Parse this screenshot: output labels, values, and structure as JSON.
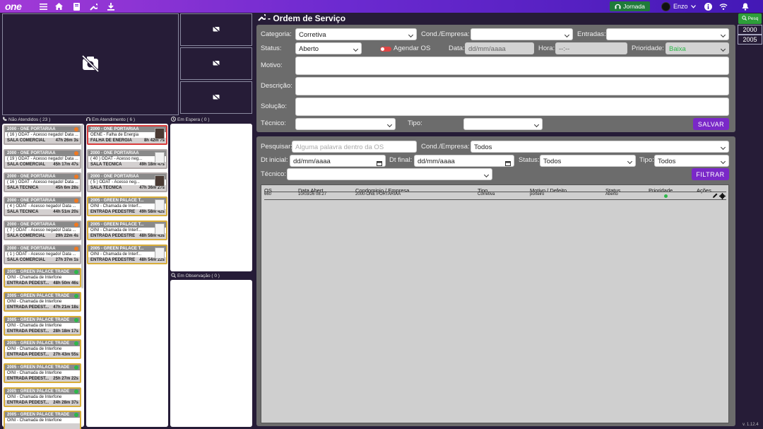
{
  "topbar": {
    "logo": "one",
    "jornada": "Jornada",
    "user": "Enzo"
  },
  "columns": {
    "nao_atendidos": "Não Atendidos ( 23 )",
    "em_atendimento": "Em Atendimento ( 6 )",
    "em_espera": "Em Espera ( 0 )",
    "em_observacao": "Em Observação ( 0 )"
  },
  "nao_atendidos": [
    {
      "h": "2000 - ONE PORTARIAA",
      "l": "( 16 ) ODAT - Acesso negado! Data ...",
      "f": "SALA COMERCIAL",
      "t": "47h 26m 3s",
      "dot": "o",
      "kind": "gray"
    },
    {
      "h": "2000 - ONE PORTARIAA",
      "l": "( 19 ) ODAT - Acesso negado! Data ...",
      "f": "SALA COMERCIAL",
      "t": "45h 17m 47s",
      "dot": "o",
      "kind": "gray"
    },
    {
      "h": "2000 - ONE PORTARIAA",
      "l": "( 16 ) ODAT - Acesso negado! Data ...",
      "f": "SALA TECNICA",
      "t": "45h 6m 28s",
      "dot": "o",
      "kind": "gray"
    },
    {
      "h": "2000 - ONE PORTARIAA",
      "l": "( 4 ) ODAT - Acesso negado! Data ...",
      "f": "SALA TECNICA",
      "t": "44h 51m 20s",
      "dot": "o",
      "kind": "gray"
    },
    {
      "h": "2000 - ONE PORTARIAA",
      "l": "( 7 ) ODAT - Acesso negado! Data ...",
      "f": "SALA COMERCIAL",
      "t": "29h 22m 4s",
      "dot": "o",
      "kind": "gray"
    },
    {
      "h": "2000 - ONE PORTARIAA",
      "l": "( 1 ) ODAT - Acesso negado! Data ...",
      "f": "SALA COMERCIAL",
      "t": "27h 37m 1s",
      "dot": "o",
      "kind": "gray"
    },
    {
      "h": "2005 - GREEN PALACE TRADE",
      "l": "OINI - Chamada de Interfone",
      "f": "ENTRADA PEDEST...",
      "t": "48h 50m 46s",
      "dot": "g",
      "kind": "green"
    },
    {
      "h": "2005 - GREEN PALACE TRADE",
      "l": "OINI - Chamada de Interfone",
      "f": "ENTRADA PEDEST...",
      "t": "47h 21m 18s",
      "dot": "g",
      "kind": "green"
    },
    {
      "h": "2005 - GREEN PALACE TRADE",
      "l": "OINI - Chamada de Interfone",
      "f": "ENTRADA PEDEST...",
      "t": "28h 18m 17s",
      "dot": "g",
      "kind": "green"
    },
    {
      "h": "2005 - GREEN PALACE TRADE",
      "l": "OINI - Chamada de Interfone",
      "f": "ENTRADA PEDEST...",
      "t": "27h 43m 55s",
      "dot": "g",
      "kind": "green"
    },
    {
      "h": "2005 - GREEN PALACE TRADE",
      "l": "OINI - Chamada de Interfone",
      "f": "ENTRADA PEDEST...",
      "t": "25h 27m 22s",
      "dot": "g",
      "kind": "green"
    },
    {
      "h": "2005 - GREEN PALACE TRADE",
      "l": "OINI - Chamada de Interfone",
      "f": "ENTRADA PEDEST...",
      "t": "24h 28m 37s",
      "dot": "g",
      "kind": "green"
    },
    {
      "h": "2005 - GREEN PALACE TRADE",
      "l": "OINI - Chamada de Interfone",
      "f": "",
      "t": "",
      "dot": "g",
      "kind": "green"
    }
  ],
  "em_atendimento": [
    {
      "h": "2000 - ONE PORTARIAA",
      "l": "OENE - Falha de Energia",
      "f": "FALHA DE ENERGIA",
      "t": "8h 42m 7s",
      "kind": "red",
      "thumb": "face"
    },
    {
      "h": "2000 - ONE PORTARIAA",
      "l": "( 40 ) ODAT - Acesso neg...",
      "f": "SALA TECNICA",
      "t": "49h 18m 47s",
      "kind": "gray",
      "thumb": "ph"
    },
    {
      "h": "2000 - ONE PORTARIAA",
      "l": "( 5 ) ODAT - Acesso neg...",
      "f": "SALA TECNICA",
      "t": "47h 36m 27s",
      "kind": "gray",
      "thumb": "face"
    },
    {
      "h": "2005 - GREEN PALACE T...",
      "l": "OINI - Chamada de Interf...",
      "f": "ENTRADA PEDESTRE",
      "t": "49h 58m 42s",
      "kind": "green",
      "thumb": "ph"
    },
    {
      "h": "2005 - GREEN PALACE T...",
      "l": "OINI - Chamada de Interf...",
      "f": "ENTRADA PEDESTRE",
      "t": "48h 58m 43s",
      "kind": "green",
      "thumb": "ph"
    },
    {
      "h": "2005 - GREEN PALACE T...",
      "l": "OINI - Chamada de Interf...",
      "f": "ENTRADA PEDESTRE",
      "t": "48h 54m 22s",
      "kind": "green",
      "thumb": "ph"
    }
  ],
  "os_form": {
    "title": "- Ordem de Serviço",
    "categoria_label": "Categoria:",
    "categoria": "Corretiva",
    "cond_label": "Cond./Empresa:",
    "cond": "",
    "entradas_label": "Entradas:",
    "entradas": "",
    "status_label": "Status:",
    "status": "Aberto",
    "agendar_label": "Agendar OS",
    "data_label": "Data:",
    "data": "dd/mm/aaaa",
    "hora_label": "Hora:",
    "hora": "--:--",
    "prioridade_label": "Prioridade:",
    "prioridade": "Baixa",
    "motivo_label": "Motivo:",
    "descricao_label": "Descrição:",
    "solucao_label": "Solução:",
    "tecnico_label": "Técnico:",
    "tipo_label": "Tipo:",
    "salvar": "SALVAR"
  },
  "filter": {
    "pesquisar_label": "Pesquisar:",
    "pesquisar_ph": "Alguma palavra dentro da OS",
    "cond_label": "Cond./Empresa:",
    "cond": "Todos",
    "dt_inicial_label": "Dt inicial:",
    "dt_inicial": "dd/mm/aaaa",
    "dt_final_label": "Dt final:",
    "dt_final": "dd/mm/aaaa",
    "status_label": "Status:",
    "status": "Todos",
    "tipo_label": "Tipo:",
    "tipo": "Todos",
    "tecnico_label": "Técnico:",
    "tecnico": "",
    "filtrar": "FILTRAR"
  },
  "table": {
    "headers": [
      "OS",
      "Data Abert.",
      "Condominio / Empresa",
      "Tipo",
      "Motivo / Defeito",
      "Status",
      "Prioridade",
      "Ações"
    ],
    "row": {
      "os": "660",
      "data": "10/03/26 08:27",
      "cond": "2000-ONE PORTARIAA",
      "tipo": "Corretiva",
      "motivo": "porteiro",
      "status": "Aberto"
    }
  },
  "right": {
    "pesq": "Pesq",
    "c1": "2000",
    "c2": "2005"
  },
  "version": "v. 1.12.4"
}
